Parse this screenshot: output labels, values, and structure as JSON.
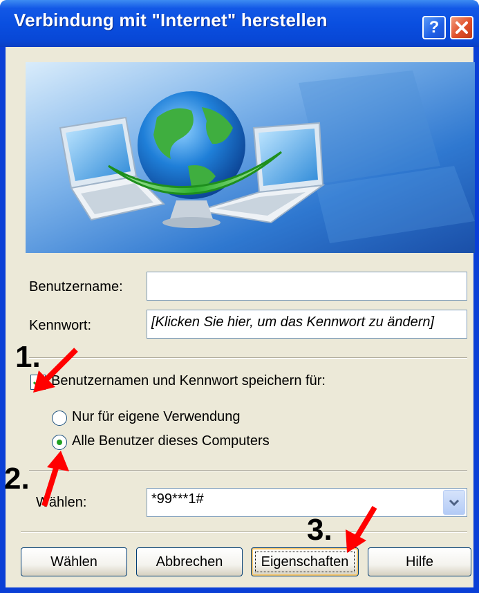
{
  "window": {
    "title": "Verbindung mit \"Internet\" herstellen",
    "help_glyph": "?",
    "close_glyph": "✕"
  },
  "form": {
    "username_label": "Benutzername:",
    "username_value": "",
    "password_label": "Kennwort:",
    "password_value": "[Klicken Sie hier, um das Kennwort zu ändern]",
    "save_checkbox_label": "Benutzernamen und Kennwort speichern für:",
    "save_checked": true,
    "radio_own_label": "Nur für eigene Verwendung",
    "radio_all_label": "Alle Benutzer dieses Computers",
    "radio_selected": "all",
    "dial_label": "Wählen:",
    "dial_value": "*99***1#"
  },
  "buttons": {
    "dial": "Wählen",
    "cancel": "Abbrechen",
    "properties": "Eigenschaften",
    "help": "Hilfe"
  },
  "annotations": {
    "step1": "1.",
    "step2": "2.",
    "step3": "3.",
    "arrow_color": "#ff0000"
  },
  "colors": {
    "titlebar": "#0a4fe0",
    "dialog_bg": "#ece9d8",
    "checkmark": "#21a121"
  }
}
